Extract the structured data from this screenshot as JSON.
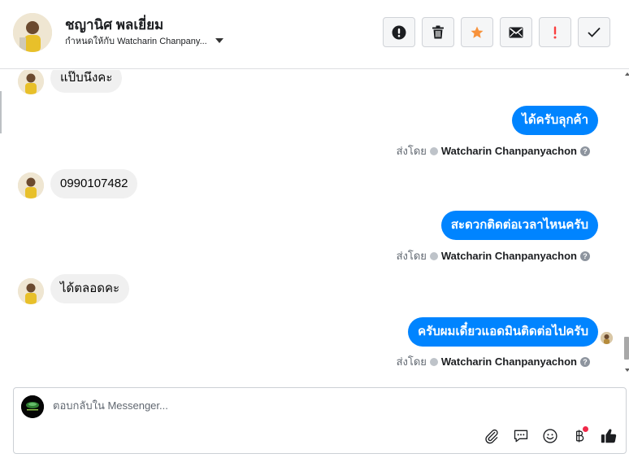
{
  "header": {
    "contact_name": "ชญานิศ พลเยี่ยม",
    "assigned_to": "กำหนดให้กับ Watcharin Chanpany...",
    "actions": [
      {
        "label": "Mark as spam",
        "icon": "alert-circle-icon"
      },
      {
        "label": "Delete",
        "icon": "trash-icon"
      },
      {
        "label": "Star",
        "icon": "star-icon",
        "color": "#f7923b"
      },
      {
        "label": "Mark as unread",
        "icon": "envelope-icon"
      },
      {
        "label": "Follow up",
        "icon": "exclamation-icon",
        "color": "#fa3e3e"
      },
      {
        "label": "Mark as done",
        "icon": "check-icon"
      }
    ]
  },
  "messages": [
    {
      "direction": "in",
      "text": "แป๊บนึงคะ"
    },
    {
      "direction": "out",
      "text": "ได้ครับลุกค้า",
      "sent_by_label": "ส่งโดย",
      "sender": "Watcharin Chanpanyachon"
    },
    {
      "direction": "in",
      "text": "0990107482"
    },
    {
      "direction": "out",
      "text": "สะดวกติดต่อเวลาไหนครับ",
      "sent_by_label": "ส่งโดย",
      "sender": "Watcharin Chanpanyachon"
    },
    {
      "direction": "in",
      "text": "ได้ตลอดคะ"
    },
    {
      "direction": "out",
      "text": "ครับผมเดี๋ยวแอดมินติดต่อไปครับ",
      "sent_by_label": "ส่งโดย",
      "sender": "Watcharin Chanpanyachon"
    }
  ],
  "composer": {
    "placeholder": "ตอบกลับใน Messenger...",
    "tools": [
      "paperclip-icon",
      "saved-reply-icon",
      "emoji-icon",
      "baht-payment-icon",
      "thumbs-up-icon"
    ]
  },
  "colors": {
    "accent": "#0084ff",
    "incoming_bubble": "#f0f0f0",
    "star": "#f7923b",
    "follow_up": "#fa3e3e",
    "notification_dot": "#f02849"
  }
}
